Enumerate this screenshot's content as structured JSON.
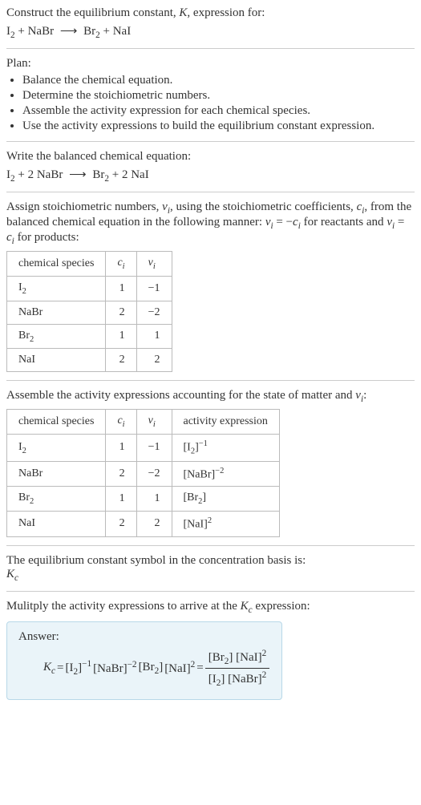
{
  "title_line": "Construct the equilibrium constant, ",
  "title_K": "K",
  "title_rest": ", expression for:",
  "reaction1": {
    "lhs": [
      {
        "formula": "I",
        "sub": "2"
      },
      {
        "plus": "+"
      },
      {
        "formula": "NaBr"
      }
    ],
    "arrow": "⟶",
    "rhs": [
      {
        "formula": "Br",
        "sub": "2"
      },
      {
        "plus": "+"
      },
      {
        "formula": "NaI"
      }
    ]
  },
  "plan_label": "Plan:",
  "plan_items": [
    "Balance the chemical equation.",
    "Determine the stoichiometric numbers.",
    "Assemble the activity expression for each chemical species.",
    "Use the activity expressions to build the equilibrium constant expression."
  ],
  "balanced_label": "Write the balanced chemical equation:",
  "reaction2": {
    "lhs": [
      {
        "formula": "I",
        "sub": "2"
      },
      {
        "plus": "+"
      },
      {
        "coef": "2",
        "formula": "NaBr"
      }
    ],
    "arrow": "⟶",
    "rhs": [
      {
        "formula": "Br",
        "sub": "2"
      },
      {
        "plus": "+"
      },
      {
        "coef": "2",
        "formula": "NaI"
      }
    ]
  },
  "assign_text_1": "Assign stoichiometric numbers, ",
  "nu_i": "ν",
  "assign_sub": "i",
  "assign_text_2": ", using the stoichiometric coefficients, ",
  "c_i": "c",
  "assign_text_3": ", from the balanced chemical equation in the following manner: ",
  "assign_eq1": " = −",
  "assign_text_4": " for reactants and ",
  "assign_eq2": " = ",
  "assign_text_5": " for products:",
  "table1": {
    "headers": {
      "species": "chemical species",
      "c": "c",
      "sub_c": "i",
      "nu": "ν",
      "sub_nu": "i"
    },
    "rows": [
      {
        "species": "I",
        "species_sub": "2",
        "c": "1",
        "nu": "−1"
      },
      {
        "species": "NaBr",
        "c": "2",
        "nu": "−2"
      },
      {
        "species": "Br",
        "species_sub": "2",
        "c": "1",
        "nu": "1"
      },
      {
        "species": "NaI",
        "c": "2",
        "nu": "2"
      }
    ]
  },
  "activity_label_1": "Assemble the activity expressions accounting for the state of matter and ",
  "activity_label_2": ":",
  "table2": {
    "headers": {
      "species": "chemical species",
      "c": "c",
      "sub_c": "i",
      "nu": "ν",
      "sub_nu": "i",
      "act": "activity expression"
    },
    "rows": [
      {
        "species": "I",
        "species_sub": "2",
        "c": "1",
        "nu": "−1",
        "act_base": "[I",
        "act_sub": "2",
        "act_close": "]",
        "act_exp": "−1"
      },
      {
        "species": "NaBr",
        "c": "2",
        "nu": "−2",
        "act_base": "[NaBr]",
        "act_exp": "−2"
      },
      {
        "species": "Br",
        "species_sub": "2",
        "c": "1",
        "nu": "1",
        "act_base": "[Br",
        "act_sub": "2",
        "act_close": "]"
      },
      {
        "species": "NaI",
        "c": "2",
        "nu": "2",
        "act_base": "[NaI]",
        "act_exp": "2"
      }
    ]
  },
  "symbol_line": "The equilibrium constant symbol in the concentration basis is:",
  "Kc": "K",
  "Kc_sub": "c",
  "multiply_line": "Mulitply the activity expressions to arrive at the ",
  "multiply_line_end": " expression:",
  "answer_label": "Answer:",
  "final": {
    "lhs_K": "K",
    "lhs_Ksub": "c",
    "eq": " = ",
    "terms": [
      {
        "open": "[I",
        "sub": "2",
        "close": "]",
        "exp": "−1"
      },
      {
        "open": "[NaBr]",
        "exp": "−2"
      },
      {
        "open": "[Br",
        "sub": "2",
        "close": "]"
      },
      {
        "open": "[NaI]",
        "exp": "2"
      }
    ],
    "eq2": " = ",
    "frac_num": [
      {
        "open": "[Br",
        "sub": "2",
        "close": "]"
      },
      {
        "open": "[NaI]",
        "exp": "2"
      }
    ],
    "frac_den": [
      {
        "open": "[I",
        "sub": "2",
        "close": "]"
      },
      {
        "open": "[NaBr]",
        "exp": "2"
      }
    ]
  },
  "chart_data": {
    "type": "table",
    "stoichiometry": [
      {
        "species": "I2",
        "c_i": 1,
        "nu_i": -1
      },
      {
        "species": "NaBr",
        "c_i": 2,
        "nu_i": -2
      },
      {
        "species": "Br2",
        "c_i": 1,
        "nu_i": 1
      },
      {
        "species": "NaI",
        "c_i": 2,
        "nu_i": 2
      }
    ],
    "activity": [
      {
        "species": "I2",
        "c_i": 1,
        "nu_i": -1,
        "activity_expression": "[I2]^-1"
      },
      {
        "species": "NaBr",
        "c_i": 2,
        "nu_i": -2,
        "activity_expression": "[NaBr]^-2"
      },
      {
        "species": "Br2",
        "c_i": 1,
        "nu_i": 1,
        "activity_expression": "[Br2]"
      },
      {
        "species": "NaI",
        "c_i": 2,
        "nu_i": 2,
        "activity_expression": "[NaI]^2"
      }
    ],
    "equilibrium_constant": "Kc = [Br2][NaI]^2 / ([I2][NaBr]^2)"
  }
}
